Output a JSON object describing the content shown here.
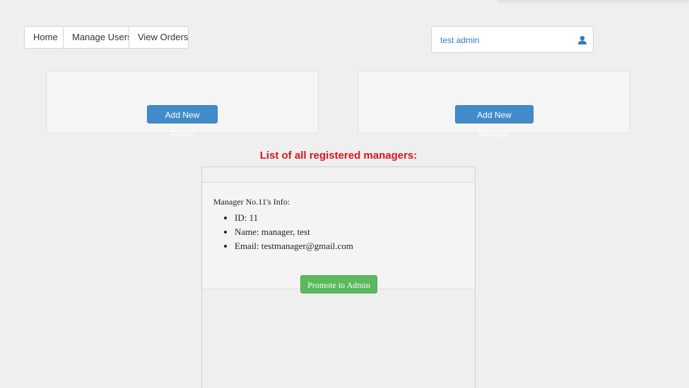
{
  "nav": {
    "home": "Home",
    "manage_users": "Manage Users",
    "view_orders": "View Orders"
  },
  "user": {
    "name": "test admin",
    "icon": "user-icon"
  },
  "actions": {
    "add_admin": "Add New Admin",
    "add_manager": "Add New Manager"
  },
  "list": {
    "title": "List of all registered managers:",
    "managers": [
      {
        "heading": "Manager No.11's Info:",
        "id": "ID: 11",
        "name": "Name: manager, test",
        "email": "Email: testmanager@gmail.com",
        "promote_label": "Promote to Admin"
      }
    ]
  },
  "colors": {
    "primary": "#428bca",
    "success": "#5cb85c",
    "title_red": "#e0141b",
    "link_blue": "#337ab7"
  }
}
